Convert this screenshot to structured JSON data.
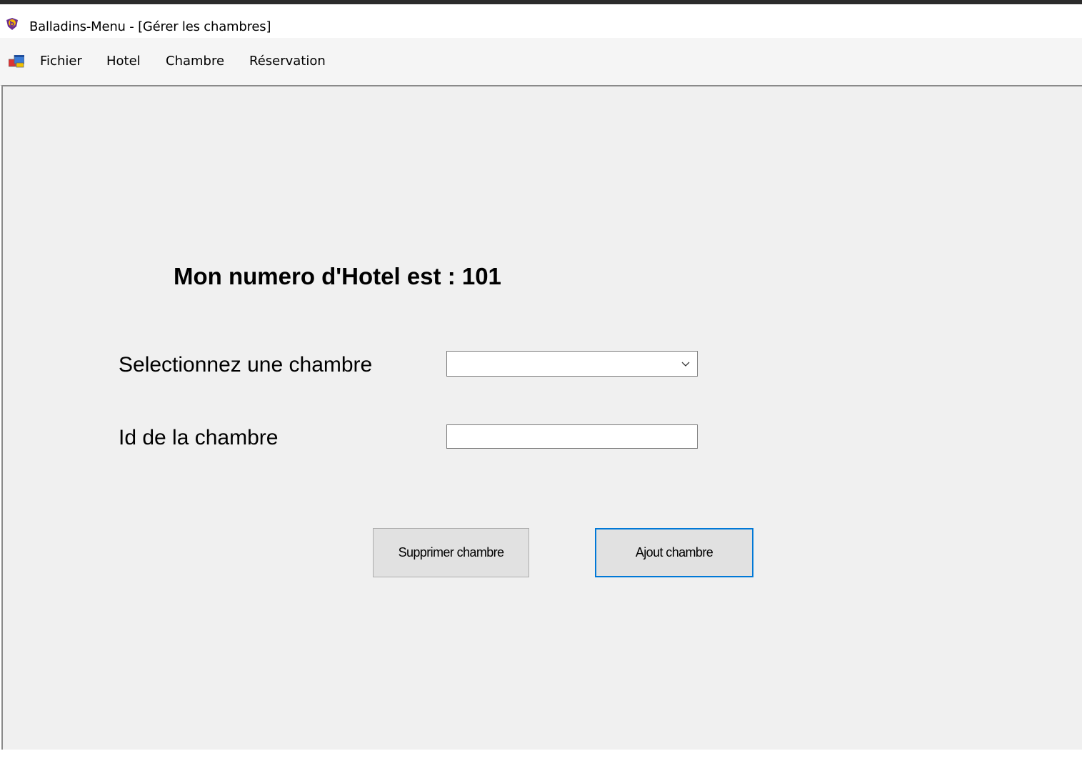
{
  "window": {
    "title": "Balladins-Menu - [Gérer les chambres]",
    "icon": "balladins-logo-icon"
  },
  "menubar": {
    "mdi_icon": "mdi-child-window-icon",
    "items": [
      {
        "label": "Fichier"
      },
      {
        "label": "Hotel"
      },
      {
        "label": "Chambre"
      },
      {
        "label": "Réservation"
      }
    ]
  },
  "form": {
    "heading": "Mon numero d'Hotel est : 101",
    "select_label": "Selectionnez une chambre",
    "select_value": "",
    "id_label": "Id de la chambre",
    "id_value": "",
    "delete_button": "Supprimer chambre",
    "add_button": "Ajout chambre"
  },
  "colors": {
    "client_background": "#f0f0f0",
    "default_button_border": "#0078d7",
    "button_background": "#e1e1e1"
  }
}
